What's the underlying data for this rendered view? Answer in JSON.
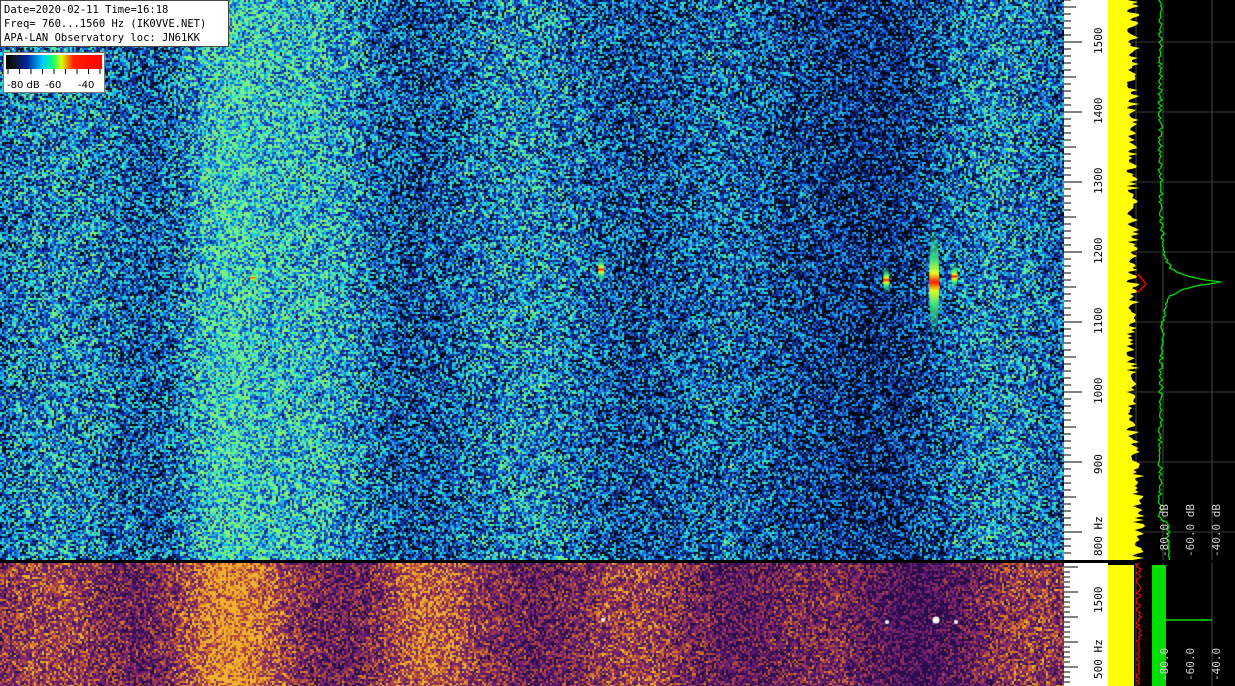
{
  "info": {
    "line1": "Date=2020-02-11 Time=16:18",
    "line2": "Freq= 760...1560 Hz (IK0VVE.NET)",
    "line3": "APA-LAN Observatory loc: JN61KK"
  },
  "color_scale": {
    "labels": [
      "-80 dB",
      "-60",
      "-40"
    ]
  },
  "freq_axis_main": {
    "labels": [
      "1500",
      "1400",
      "1300",
      "1200",
      "1100",
      "1000",
      "900",
      "800 Hz"
    ],
    "range_hz": [
      760,
      1560
    ]
  },
  "freq_axis_lower": {
    "labels": [
      "1500",
      "500 Hz"
    ]
  },
  "spectrum_axis_main": {
    "labels": [
      "-80.0 dB",
      "-60.0 dB",
      "-40.0 dB"
    ]
  },
  "spectrum_axis_lower": {
    "labels": [
      "-80.0",
      "-60.0",
      "-40.0"
    ]
  },
  "signals": [
    {
      "name": "carrier-strong",
      "freq_hz": 1157,
      "time_pos": 0.878,
      "strength": "strong"
    },
    {
      "name": "carrier-1",
      "freq_hz": 1160,
      "time_pos": 0.833,
      "strength": "medium"
    },
    {
      "name": "carrier-2",
      "freq_hz": 1165,
      "time_pos": 0.897,
      "strength": "medium"
    },
    {
      "name": "carrier-3",
      "freq_hz": 1175,
      "time_pos": 0.565,
      "strength": "medium"
    },
    {
      "name": "carrier-4",
      "freq_hz": 1163,
      "time_pos": 0.238,
      "strength": "weak"
    }
  ],
  "colors": {
    "waterfall_base": "#0a1f62",
    "lower_waterfall_base": "#3e1459",
    "spectrum_yellow": "#ffff00",
    "spectrum_green": "#00e000",
    "peak_red": "#ff0000"
  }
}
